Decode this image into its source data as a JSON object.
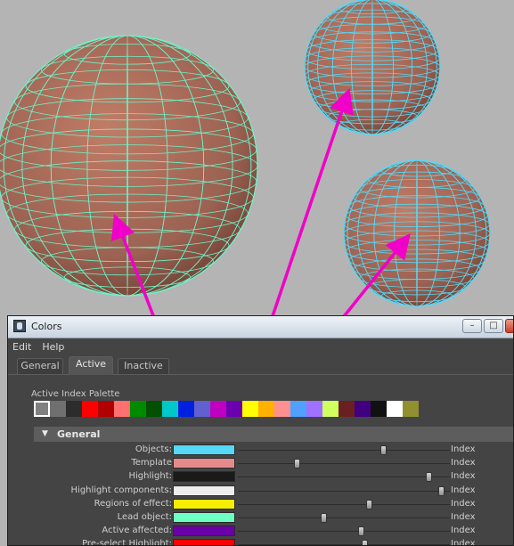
{
  "window": {
    "title": "Colors",
    "minimize_symbol": "–",
    "maximize_symbol": "□",
    "close_symbol": "✕"
  },
  "menu": [
    "Edit",
    "Help"
  ],
  "tabs": [
    {
      "label": "General",
      "active": false
    },
    {
      "label": "Active",
      "active": true
    },
    {
      "label": "Inactive",
      "active": false
    }
  ],
  "palette": {
    "label": "Active Index Palette",
    "selected_index": 0,
    "swatches": [
      "#808080",
      "#707070",
      "#2c2c2c",
      "#ff0000",
      "#b00000",
      "#ff7070",
      "#008a00",
      "#005000",
      "#00c8c8",
      "#0020e0",
      "#6060d0",
      "#c000c0",
      "#6a00b0",
      "#ffff00",
      "#ffb000",
      "#ff9090",
      "#50a0ff",
      "#a070ff",
      "#d0ff60",
      "#6a2020",
      "#400080",
      "#111111",
      "#ffffff",
      "#909030"
    ]
  },
  "section": {
    "title": "General",
    "chevron": "▼"
  },
  "rows": [
    {
      "label": "Objects:",
      "color": "#55d8f6",
      "slider": 0.69,
      "index_label": "Index"
    },
    {
      "label": "Template",
      "color": "#e58a8a",
      "slider": 0.27,
      "index_label": "Index"
    },
    {
      "label": "Highlight:",
      "color": "#1a1a1a",
      "slider": 0.91,
      "index_label": "Index"
    },
    {
      "label": "Highlight components:",
      "color": "#eeeeee",
      "slider": 0.97,
      "index_label": "Index"
    },
    {
      "label": "Regions of effect:",
      "color": "#f5ee00",
      "slider": 0.62,
      "index_label": "Index"
    },
    {
      "label": "Lead object:",
      "color": "#6effc4",
      "slider": 0.4,
      "index_label": "Index"
    },
    {
      "label": "Active affected:",
      "color": "#6a00a8",
      "slider": 0.58,
      "index_label": "Index"
    },
    {
      "label": "Pre-select Highlight:",
      "color": "#ff0000",
      "slider": 0.6,
      "index_label": "Index"
    }
  ],
  "viewport": {
    "background": "#b4b4b4",
    "sphere_color": "#a86a58",
    "wire_color_large": "#6ef2c8",
    "wire_color_small": "#55d8f6",
    "arrow_color": "#f000c8"
  }
}
